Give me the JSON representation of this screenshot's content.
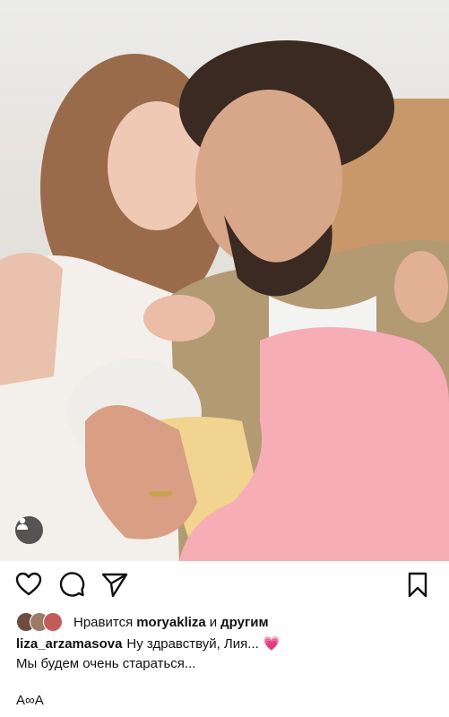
{
  "post": {
    "photo_alt": "photo",
    "liked_prefix": "Нравится",
    "liked_user": "moryakliza",
    "liked_joiner": "и",
    "liked_others": "другим",
    "author": "liza_arzamasova",
    "caption_line1": "Ну здравствуй, Лия...",
    "caption_emoji": "💗",
    "caption_line2": "Мы будем очень стараться...",
    "footer_text": "А∞А"
  },
  "icons": {
    "like": "heart-icon",
    "comment": "comment-icon",
    "share": "send-icon",
    "save": "bookmark-icon",
    "tag": "person-icon"
  },
  "colors": {
    "accent_emoji": "#e53ba8",
    "text": "#111111"
  }
}
